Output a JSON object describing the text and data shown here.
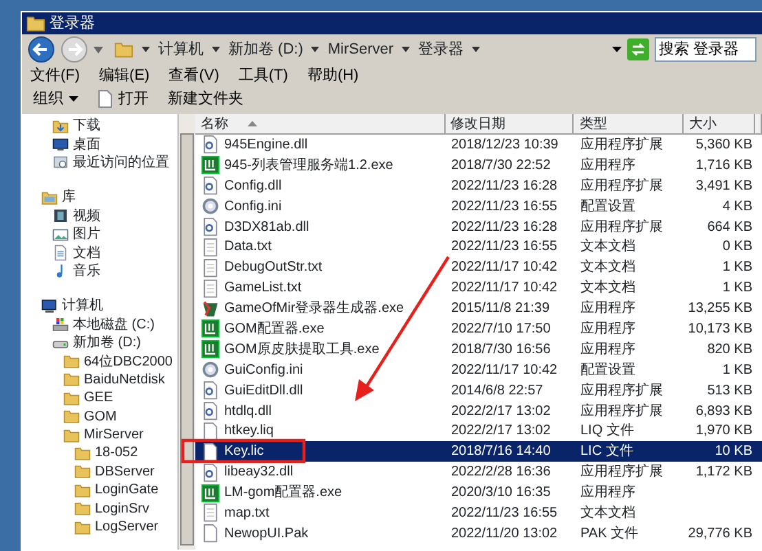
{
  "window": {
    "title": "登录器"
  },
  "address": {
    "crumbs": [
      "计算机",
      "新加卷 (D:)",
      "MirServer",
      "登录器"
    ]
  },
  "search": {
    "placeholder": "搜索 登录器"
  },
  "menu": [
    "文件(F)",
    "编辑(E)",
    "查看(V)",
    "工具(T)",
    "帮助(H)"
  ],
  "toolbar": [
    {
      "label": "组织",
      "kind": "dropdown"
    },
    {
      "label": "打开",
      "kind": "file"
    },
    {
      "label": "新建文件夹",
      "kind": "plain"
    }
  ],
  "nav": {
    "sections": [
      {
        "items": [
          {
            "label": "下载",
            "kind": "download"
          },
          {
            "label": "桌面",
            "kind": "desktop"
          },
          {
            "label": "最近访问的位置",
            "kind": "recent"
          }
        ]
      },
      {
        "header": {
          "label": "库",
          "kind": "library"
        },
        "items": [
          {
            "label": "视频",
            "kind": "video"
          },
          {
            "label": "图片",
            "kind": "picture"
          },
          {
            "label": "文档",
            "kind": "document"
          },
          {
            "label": "音乐",
            "kind": "music"
          }
        ]
      },
      {
        "header": {
          "label": "计算机",
          "kind": "computer"
        },
        "items": [
          {
            "label": "本地磁盘 (C:)",
            "kind": "system-drive"
          },
          {
            "label": "新加卷 (D:)",
            "kind": "drive",
            "children": [
              {
                "label": "64位DBC2000",
                "kind": "folder"
              },
              {
                "label": "BaiduNetdisk",
                "kind": "folder"
              },
              {
                "label": "GEE",
                "kind": "folder"
              },
              {
                "label": "GOM",
                "kind": "folder"
              },
              {
                "label": "MirServer",
                "kind": "folder",
                "children": [
                  {
                    "label": "18-052",
                    "kind": "folder"
                  },
                  {
                    "label": "DBServer",
                    "kind": "folder"
                  },
                  {
                    "label": "LoginGate",
                    "kind": "folder"
                  },
                  {
                    "label": "LoginSrv",
                    "kind": "folder"
                  },
                  {
                    "label": "LogServer",
                    "kind": "folder"
                  }
                ]
              }
            ]
          }
        ]
      }
    ]
  },
  "table": {
    "columns": [
      {
        "label": "名称",
        "sorted": true
      },
      {
        "label": "修改日期",
        "sorted": false
      },
      {
        "label": "类型",
        "sorted": false
      },
      {
        "label": "大小",
        "sorted": false
      }
    ],
    "rows": [
      {
        "name": "945Engine.dll",
        "kind": "dll",
        "date": "2018/12/23 10:39",
        "type": "应用程序扩展",
        "size": "5,360 KB",
        "selected": false
      },
      {
        "name": "945-列表管理服务端1.2.exe",
        "kind": "app",
        "date": "2018/7/30 22:52",
        "type": "应用程序",
        "size": "1,716 KB",
        "selected": false
      },
      {
        "name": "Config.dll",
        "kind": "dll",
        "date": "2022/11/23 16:28",
        "type": "应用程序扩展",
        "size": "3,491 KB",
        "selected": false
      },
      {
        "name": "Config.ini",
        "kind": "ini",
        "date": "2022/11/23 16:55",
        "type": "配置设置",
        "size": "4 KB",
        "selected": false
      },
      {
        "name": "D3DX81ab.dll",
        "kind": "dll",
        "date": "2022/11/23 16:28",
        "type": "应用程序扩展",
        "size": "664 KB",
        "selected": false
      },
      {
        "name": "Data.txt",
        "kind": "text",
        "date": "2022/11/23 16:55",
        "type": "文本文档",
        "size": "0 KB",
        "selected": false
      },
      {
        "name": "DebugOutStr.txt",
        "kind": "text",
        "date": "2022/11/17 10:42",
        "type": "文本文档",
        "size": "1 KB",
        "selected": false
      },
      {
        "name": "GameList.txt",
        "kind": "text",
        "date": "2022/11/17 10:42",
        "type": "文本文档",
        "size": "1 KB",
        "selected": false
      },
      {
        "name": "GameOfMir登录器生成器.exe",
        "kind": "game",
        "date": "2015/11/8 21:39",
        "type": "应用程序",
        "size": "13,255 KB",
        "selected": false
      },
      {
        "name": "GOM配置器.exe",
        "kind": "app",
        "date": "2022/7/10 17:50",
        "type": "应用程序",
        "size": "10,173 KB",
        "selected": false
      },
      {
        "name": "GOM原皮肤提取工具.exe",
        "kind": "app",
        "date": "2018/7/30 16:56",
        "type": "应用程序",
        "size": "820 KB",
        "selected": false
      },
      {
        "name": "GuiConfig.ini",
        "kind": "ini",
        "date": "2022/11/17 10:42",
        "type": "配置设置",
        "size": "1 KB",
        "selected": false
      },
      {
        "name": "GuiEditDll.dll",
        "kind": "dll",
        "date": "2014/6/8 22:57",
        "type": "应用程序扩展",
        "size": "513 KB",
        "selected": false
      },
      {
        "name": "htdlq.dll",
        "kind": "dll",
        "date": "2022/2/17 13:02",
        "type": "应用程序扩展",
        "size": "6,893 KB",
        "selected": false
      },
      {
        "name": "htkey.liq",
        "kind": "blank",
        "date": "2022/2/17 13:02",
        "type": "LIQ 文件",
        "size": "1,970 KB",
        "selected": false
      },
      {
        "name": "Key.lic",
        "kind": "blank",
        "date": "2018/7/16 14:40",
        "type": "LIC 文件",
        "size": "10 KB",
        "selected": true
      },
      {
        "name": "libeay32.dll",
        "kind": "dll",
        "date": "2022/2/28 16:36",
        "type": "应用程序扩展",
        "size": "1,172 KB",
        "selected": false
      },
      {
        "name": "LM-gom配置器.exe",
        "kind": "app",
        "date": "2020/3/10 16:35",
        "type": "应用程序",
        "selected": false
      },
      {
        "name": "map.txt",
        "kind": "text",
        "date": "2022/11/23 16:55",
        "type": "文本文档",
        "selected": false
      },
      {
        "name": "NewopUI.Pak",
        "kind": "blank",
        "date": "2022/11/20 13:02",
        "type": "PAK 文件",
        "size": "29,776 KB",
        "selected": false
      }
    ]
  }
}
